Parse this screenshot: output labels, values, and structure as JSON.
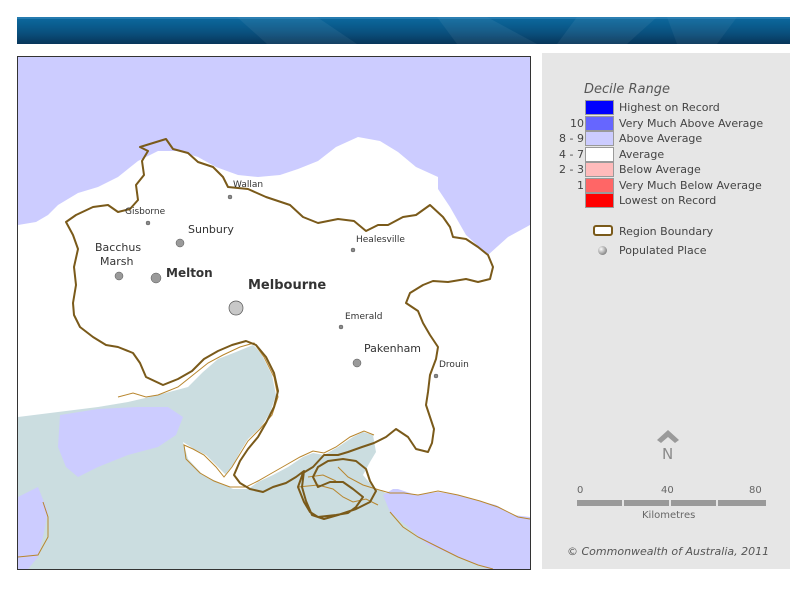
{
  "legend": {
    "title": "Decile Range",
    "items": [
      {
        "range": "",
        "label": "Highest on Record",
        "color": "#0000ff"
      },
      {
        "range": "10",
        "label": "Very Much Above Average",
        "color": "#6666ff"
      },
      {
        "range": "8 - 9",
        "label": "Above Average",
        "color": "#ccccff"
      },
      {
        "range": "4 - 7",
        "label": "Average",
        "color": "#ffffff"
      },
      {
        "range": "2 - 3",
        "label": "Below Average",
        "color": "#ffbbbb"
      },
      {
        "range": "1",
        "label": "Very Much Below Average",
        "color": "#ff6666"
      },
      {
        "range": "",
        "label": "Lowest on Record",
        "color": "#ff0000"
      }
    ],
    "boundary_label": "Region Boundary",
    "boundary_color": "#7a5a1a",
    "place_label": "Populated Place"
  },
  "scale": {
    "ticks": [
      "0",
      "40",
      "80"
    ],
    "units": "Kilometres"
  },
  "north_label": "N",
  "copyright": "© Commonwealth of Australia, 2011",
  "places": [
    {
      "name": "Wallan",
      "icon": "populated-place-icon"
    },
    {
      "name": "Gisborne",
      "icon": "populated-place-icon"
    },
    {
      "name": "Sunbury",
      "icon": "populated-place-icon"
    },
    {
      "name": "Healesville",
      "icon": "populated-place-icon"
    },
    {
      "name": "Bacchus",
      "icon": "populated-place-icon"
    },
    {
      "name": "Marsh",
      "icon": "populated-place-icon"
    },
    {
      "name": "Melton",
      "icon": "populated-place-icon"
    },
    {
      "name": "Melbourne",
      "icon": "populated-place-icon"
    },
    {
      "name": "Emerald",
      "icon": "populated-place-icon"
    },
    {
      "name": "Pakenham",
      "icon": "populated-place-icon"
    },
    {
      "name": "Drouin",
      "icon": "populated-place-icon"
    }
  ],
  "colors": {
    "sea": "#cbdde0",
    "above_average": "#ccccff",
    "average": "#ffffff",
    "coastline": "#b8862e"
  }
}
